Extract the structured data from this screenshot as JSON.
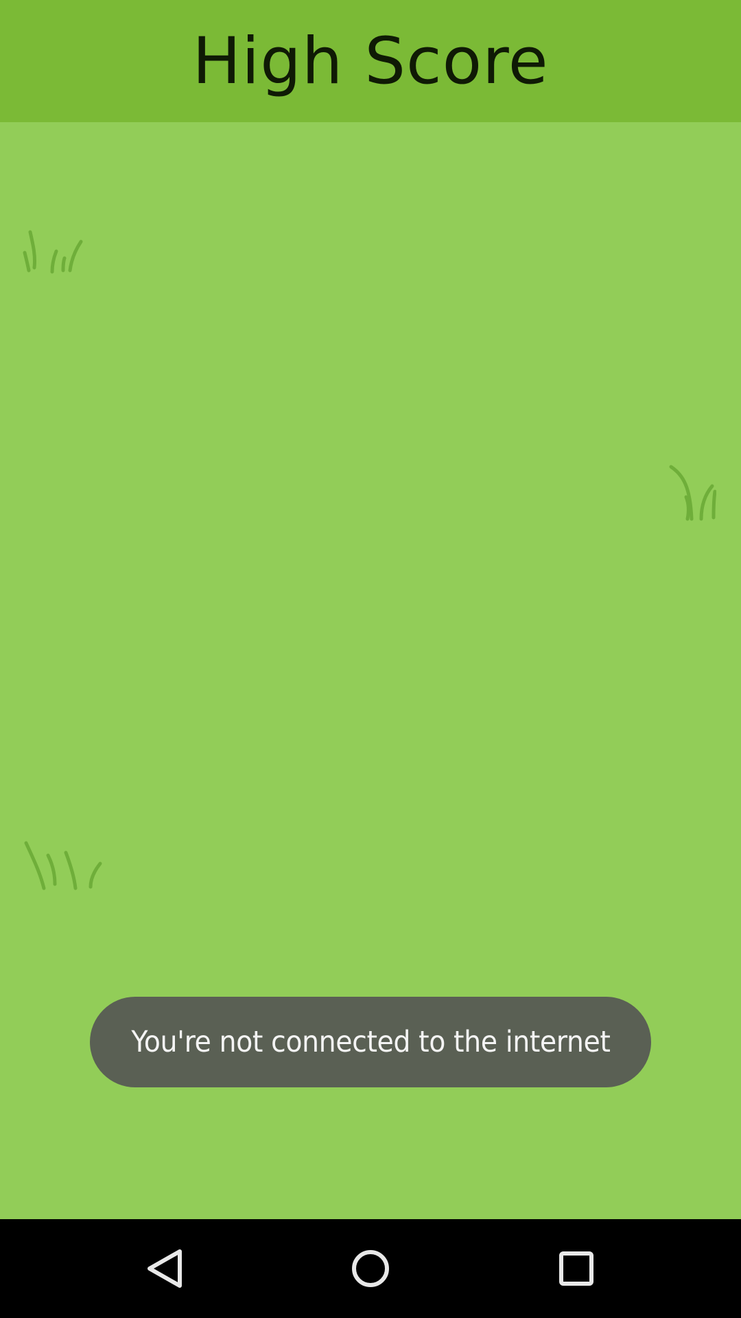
{
  "header": {
    "title": "High Score"
  },
  "toast": {
    "message": "You're not connected to the internet"
  },
  "decorations": {
    "icons": [
      "grass-tuft-icon",
      "grass-tuft-icon",
      "grass-tuft-icon"
    ]
  },
  "navbar": {
    "icons": [
      "back-icon",
      "home-icon",
      "recent-apps-icon"
    ]
  },
  "colors": {
    "header_bg": "#7bba36",
    "background": "#92cd58",
    "toast_bg": "#5a6054",
    "navbar_bg": "#000000"
  }
}
